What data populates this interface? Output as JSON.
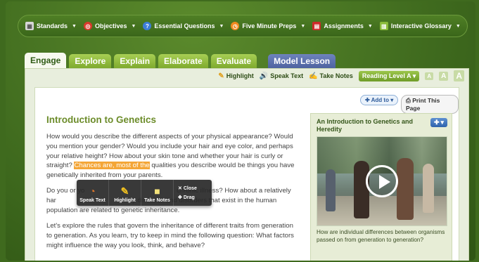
{
  "toolbar": {
    "items": [
      {
        "label": "Standards",
        "icon": "standards-icon",
        "color": "#e8e8e8"
      },
      {
        "label": "Objectives",
        "icon": "target-icon",
        "color": "#d83a2b"
      },
      {
        "label": "Essential Questions",
        "icon": "question-icon",
        "color": "#3d7dd8"
      },
      {
        "label": "Five Minute Preps",
        "icon": "clock-icon",
        "color": "#f08a1f"
      },
      {
        "label": "Assignments",
        "icon": "assignment-icon",
        "color": "#cc2a2a"
      },
      {
        "label": "Interactive Glossary",
        "icon": "glossary-icon",
        "color": "#8abb3a"
      }
    ]
  },
  "tabs": [
    "Engage",
    "Explore",
    "Explain",
    "Elaborate",
    "Evaluate",
    "Model Lesson"
  ],
  "utility": {
    "highlight": "Highlight",
    "speak_text": "Speak Text",
    "take_notes": "Take Notes",
    "reading_level": "Reading Level A",
    "font_sizes": [
      "A",
      "A",
      "A"
    ]
  },
  "actions": {
    "add_to": "Add to",
    "print": "Print This Page"
  },
  "article": {
    "title": "Introduction to Genetics",
    "p1_before": "How would you describe the different aspects of your physical appearance? Would you mention your gender? Would you include your hair and eye color, and perhaps your relative height? How about your skin tone and whether your hair is curly or straight? ",
    "p1_highlight": "Chances are, most of the",
    "p1_after": " qualities you describe would be things you have genetically inherited from your parents.",
    "p2_a": "Do you or yo",
    "p2_b": " chronic illness? How about a relatively har",
    "p2_c": "y diseases and disorders that exist in the human population are related to genetic inheritance.",
    "p3": "Let's explore the rules that govern the inheritance of different traits from generation to generation. As you learn, try to keep in mind the following question: What factors might influence the way you look, think, and behave?"
  },
  "sidebar": {
    "title": "An Introduction to Genetics and Heredity",
    "caption": "How are individual differences between organisms passed on from generation to generation?"
  },
  "popup": {
    "speak_text": "Speak Text",
    "highlight": "Highlight",
    "take_notes": "Take Notes",
    "close": "Close",
    "drag": "Drag"
  }
}
